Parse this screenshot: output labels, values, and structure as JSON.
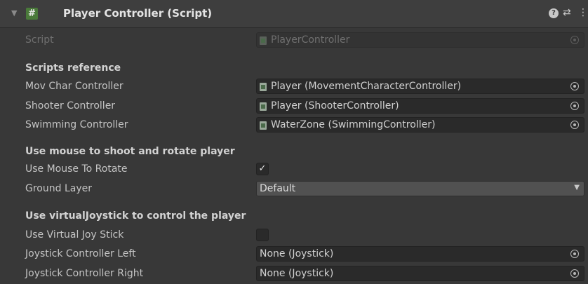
{
  "component": {
    "title": "Player Controller (Script)",
    "header_icon": "hash-icon",
    "collapse_icon": "fold-triangle-icon",
    "help_icon": "help-icon",
    "presets_icon": "presets-icon",
    "menu_icon": "kebab-menu-icon"
  },
  "script": {
    "label": "Script",
    "value": "PlayerController"
  },
  "sections": {
    "scripts_reference": "Scripts reference",
    "mouse": "Use mouse to shoot and rotate player",
    "joystick": "Use virtualJoystick to control the player"
  },
  "fields": {
    "mov_char": {
      "label": "Mov Char Controller",
      "value": "Player (MovementCharacterController)"
    },
    "shooter": {
      "label": "Shooter Controller",
      "value": "Player (ShooterController)"
    },
    "swimming": {
      "label": "Swimming Controller",
      "value": "WaterZone (SwimmingController)"
    },
    "use_mouse_rotate": {
      "label": "Use Mouse To Rotate",
      "checked": true,
      "mark": "✓"
    },
    "ground_layer": {
      "label": "Ground Layer",
      "value": "Default"
    },
    "use_virtual_joystick": {
      "label": "Use Virtual Joy Stick",
      "checked": false
    },
    "joystick_left": {
      "label": "Joystick Controller Left",
      "value": "None (Joystick)"
    },
    "joystick_right": {
      "label": "Joystick Controller Right",
      "value": "None (Joystick)"
    }
  },
  "colors": {
    "background": "#383838",
    "header": "#3e3e3e",
    "field": "#2a2a2a",
    "script_icon": "#9aa89a"
  }
}
